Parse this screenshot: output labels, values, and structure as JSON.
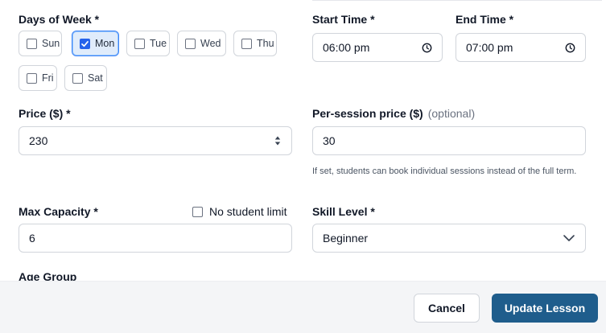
{
  "days_of_week": {
    "label": "Days of Week *",
    "days": [
      {
        "label": "Sun",
        "checked": false
      },
      {
        "label": "Mon",
        "checked": true
      },
      {
        "label": "Tue",
        "checked": false
      },
      {
        "label": "Wed",
        "checked": false
      },
      {
        "label": "Thu",
        "checked": false
      },
      {
        "label": "Fri",
        "checked": false
      },
      {
        "label": "Sat",
        "checked": false
      }
    ]
  },
  "start_time": {
    "label": "Start Time *",
    "value": "06:00 pm"
  },
  "end_time": {
    "label": "End Time *",
    "value": "07:00 pm"
  },
  "price": {
    "label": "Price ($) *",
    "value": "230"
  },
  "per_session_price": {
    "label": "Per-session price ($)",
    "optional": "(optional)",
    "value": "30",
    "help": "If set, students can book individual sessions instead of the full term."
  },
  "max_capacity": {
    "label": "Max Capacity *",
    "value": "6",
    "no_limit_label": "No student limit",
    "no_limit_checked": false
  },
  "skill_level": {
    "label": "Skill Level *",
    "value": "Beginner"
  },
  "age_group": {
    "label": "Age Group"
  },
  "footer": {
    "cancel_label": "Cancel",
    "submit_label": "Update Lesson"
  },
  "colors": {
    "primary_button": "#1f5d8c",
    "selected_day_bg": "#e0ecfb",
    "checkbox_checked": "#2563eb"
  },
  "icons": {
    "time": "clock-icon",
    "stepper": "stepper-arrows-icon",
    "dropdown": "chevron-down-icon",
    "check": "checkmark-icon"
  }
}
